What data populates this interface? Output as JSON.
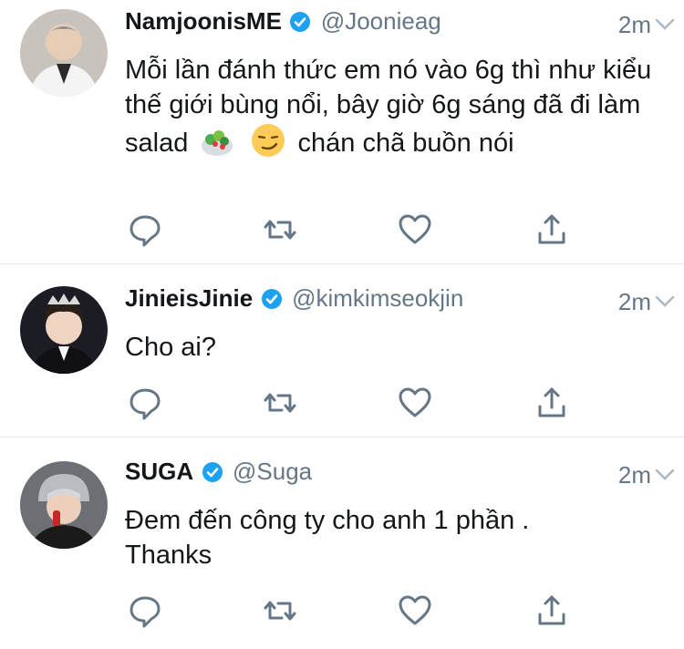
{
  "tweets": [
    {
      "name": "NamjoonisME",
      "handle": "@Joonieag",
      "time": "2m",
      "text_parts": [
        "Mỗi lần đánh thức em nó vào 6g thì như kiểu thế giới bùng nổi, bây giờ 6g sáng đã đi làm salad",
        "chán chã buồn nói"
      ],
      "emojis": [
        "salad-emoji",
        "smirk-emoji"
      ],
      "avatar": "namjoon-avatar"
    },
    {
      "name": "JinieisJinie",
      "handle": "@kimkimseokjin",
      "time": "2m",
      "text": "Cho ai?",
      "avatar": "jin-avatar"
    },
    {
      "name": "SUGA",
      "handle": "@Suga",
      "time": "2m",
      "text": "Đem đến công ty cho anh 1 phần . Thanks",
      "avatar": "suga-avatar"
    }
  ],
  "icons": {
    "reply": "reply-icon",
    "retweet": "retweet-icon",
    "like": "heart-icon",
    "share": "share-icon",
    "verified": "verified-badge-icon",
    "menu": "chevron-down-icon"
  },
  "colors": {
    "name": "#14171a",
    "secondary": "#657786",
    "verified": "#1da1f2",
    "divider": "#e1e8ed",
    "icon": "#657786"
  }
}
